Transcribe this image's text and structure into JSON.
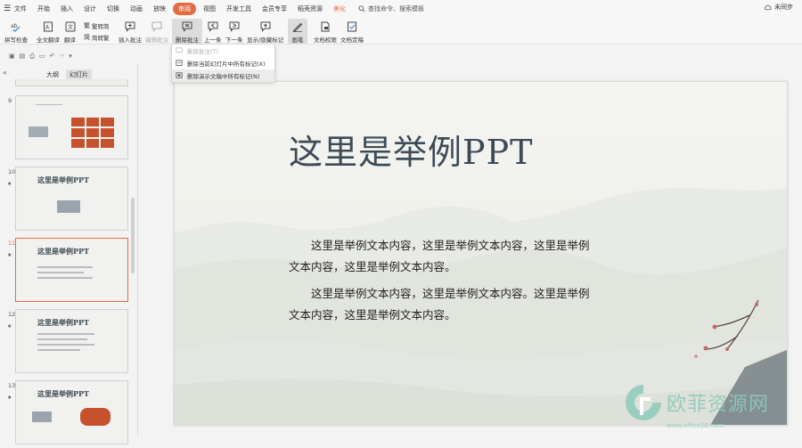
{
  "menu": {
    "file": "文件",
    "items": [
      "开始",
      "插入",
      "设计",
      "切换",
      "动画",
      "放映",
      "审阅",
      "视图",
      "开发工具",
      "会员专享",
      "稻壳资源"
    ],
    "active_item": "审阅",
    "tail_label": "美化",
    "search_placeholder": "查找命令、搜索模板",
    "sync_label": "未同步"
  },
  "ribbon": {
    "spell_check": "拼写检查",
    "full_translate": "全文翻译",
    "translate": "翻译",
    "simp_to_trad": "繁转简",
    "trad_to_simp": "简转繁",
    "insert_comment": "插入批注",
    "edit_comment": "编辑批注",
    "delete_comment": "删除批注",
    "prev": "上一条",
    "next": "下一条",
    "show_hide_marks": "显示/隐藏标记",
    "ink": "画笔",
    "doc_permission": "文档权限",
    "doc_finalize": "文档定稿"
  },
  "dropdown": {
    "items": [
      "删除批注(T)",
      "删除当前幻灯片中所有标记(X)",
      "删除演示文稿中所有标记(N)"
    ]
  },
  "left_panel": {
    "tab_outline": "大纲",
    "tab_slides": "幻灯片",
    "thumbnails": [
      {
        "num": "9",
        "title": ""
      },
      {
        "num": "10",
        "title": "这里是举例PPT"
      },
      {
        "num": "11",
        "title": "这里是举例PPT"
      },
      {
        "num": "12",
        "title": "这里是举例PPT"
      },
      {
        "num": "13",
        "title": "这里是举例PPT"
      }
    ],
    "selected_index": 2
  },
  "slide": {
    "title": "这里是举例PPT",
    "paragraphs": [
      "这里是举例文本内容，这里是举例文本内容，这里是举例文本内容，这里是举例文本内容。",
      "这里是举例文本内容，这里是举例文本内容。这里是举例文本内容，这里是举例文本内容。"
    ]
  },
  "watermark": {
    "text": "欧菲资源网",
    "sub": "www.office26.com"
  },
  "colors": {
    "accent": "#e36c44",
    "watermark": "#8ccabb"
  }
}
